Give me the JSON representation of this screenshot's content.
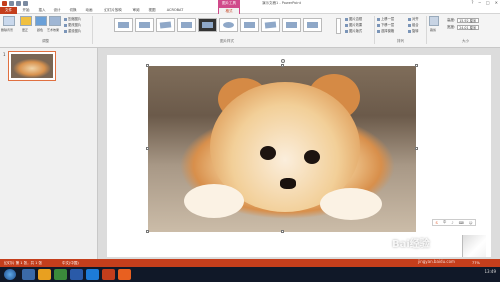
{
  "window": {
    "title": "演示文稿1 - PowerPoint",
    "contextual_tab_title": "图片工具",
    "controls": [
      "?",
      "─",
      "□",
      "✕"
    ]
  },
  "tabs": [
    {
      "label": "文件"
    },
    {
      "label": "开始"
    },
    {
      "label": "插入"
    },
    {
      "label": "设计"
    },
    {
      "label": "切换"
    },
    {
      "label": "动画"
    },
    {
      "label": "幻灯片放映"
    },
    {
      "label": "审阅"
    },
    {
      "label": "视图"
    },
    {
      "label": "ACROBAT"
    },
    {
      "label": "格式"
    }
  ],
  "ribbon": {
    "adjust_group": {
      "label": "调整",
      "remove_bg": "删除背景",
      "corrections": "更正",
      "color": "颜色",
      "artistic_effects": "艺术效果",
      "compress": "压缩图片",
      "change": "更改图片",
      "reset": "重设图片"
    },
    "styles_group": {
      "label": "图片样式"
    },
    "style_options": [
      {
        "label": "图片边框"
      },
      {
        "label": "图片效果"
      },
      {
        "label": "图片版式"
      }
    ],
    "arrange_group": {
      "label": "排列",
      "items": [
        "上移一层",
        "下移一层",
        "选择窗格",
        "对齐",
        "组合",
        "旋转"
      ]
    },
    "size_group": {
      "label": "大小",
      "crop": "裁剪",
      "height_label": "高度:",
      "height_value": "15.92 厘米",
      "width_label": "宽度:",
      "width_value": "24.01 厘米"
    }
  },
  "thumbnails": {
    "slide_number": "1"
  },
  "floatbar": {
    "items": [
      "S",
      "中",
      "♪",
      "⌨",
      "☺"
    ]
  },
  "status": {
    "slide_info": "幻灯片 第 1 张，共 1 张",
    "language": "中文(中国)",
    "zoom": "77%"
  },
  "taskbar": {
    "time": "13:49"
  },
  "watermark": {
    "text": "Bai经验",
    "url": "jingyan.baidu.com"
  }
}
